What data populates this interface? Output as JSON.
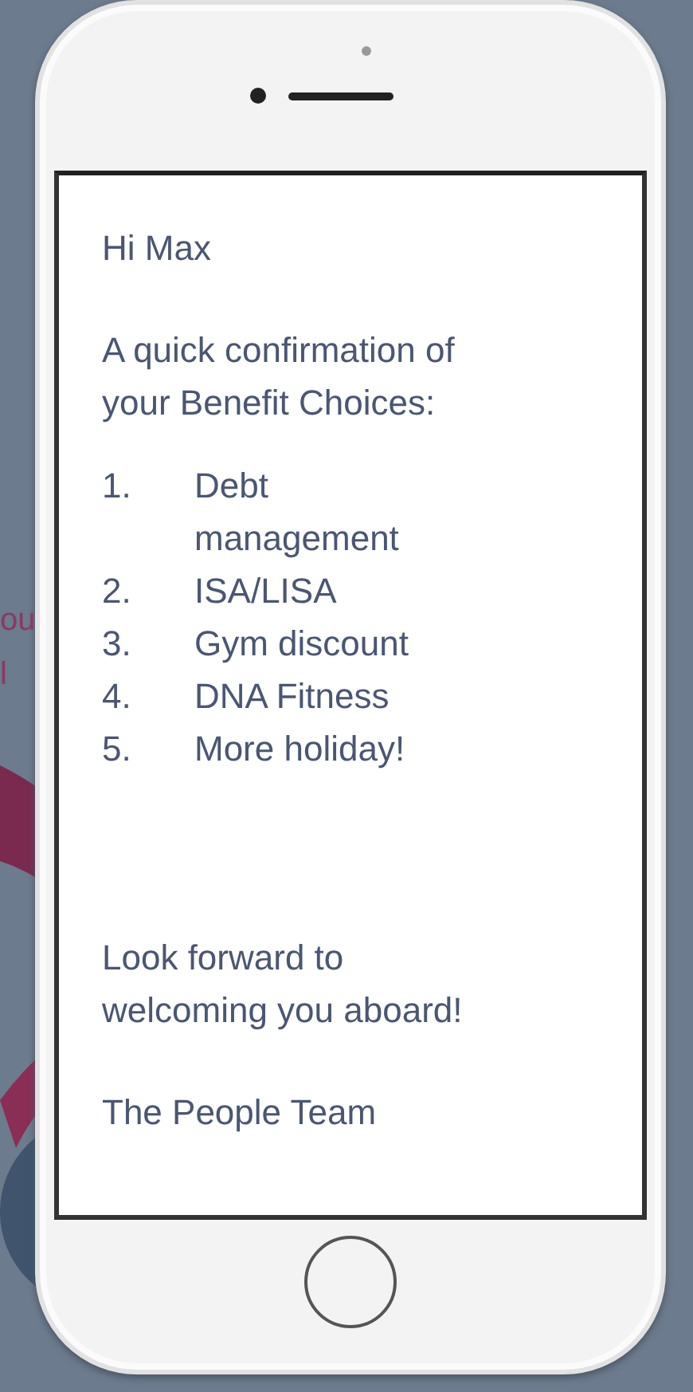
{
  "background_text": [
    "ou",
    "l"
  ],
  "message": {
    "greeting": "Hi Max",
    "intro": "A quick confirmation of your Benefit Choices:",
    "benefits": [
      {
        "number": "1.",
        "label": "Debt management"
      },
      {
        "number": "2.",
        "label": "ISA/LISA"
      },
      {
        "number": "3.",
        "label": "Gym discount"
      },
      {
        "number": "4.",
        "label": "DNA Fitness"
      },
      {
        "number": "5.",
        "label": "More holiday!"
      }
    ],
    "closing": "Look forward to welcoming you aboard!",
    "signature": "The People Team"
  }
}
